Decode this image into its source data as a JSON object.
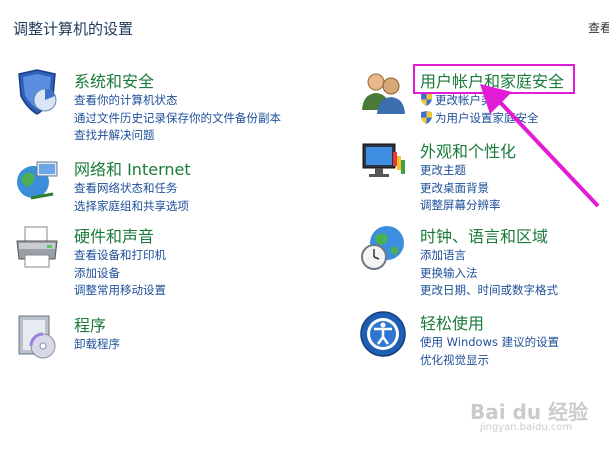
{
  "page": {
    "title": "调整计算机的设置",
    "view_by": "查看"
  },
  "categories": [
    {
      "id": "system-security",
      "icon": "shield-chart-icon",
      "title": "系统和安全",
      "links": [
        "查看你的计算机状态",
        "通过文件历史记录保存你的文件备份副本",
        "查找并解决问题"
      ]
    },
    {
      "id": "network-internet",
      "icon": "network-globe-icon",
      "title": "网络和 Internet",
      "links": [
        "查看网络状态和任务",
        "选择家庭组和共享选项"
      ]
    },
    {
      "id": "hardware-sound",
      "icon": "printer-icon",
      "title": "硬件和声音",
      "links": [
        "查看设备和打印机",
        "添加设备",
        "调整常用移动设置"
      ]
    },
    {
      "id": "programs",
      "icon": "programs-icon",
      "title": "程序",
      "links": [
        "卸载程序"
      ]
    },
    {
      "id": "user-accounts",
      "icon": "users-icon",
      "title": "用户帐户和家庭安全",
      "links": [
        "更改帐户类型",
        "为用户设置家庭安全"
      ]
    },
    {
      "id": "appearance",
      "icon": "monitor-paint-icon",
      "title": "外观和个性化",
      "links": [
        "更改主题",
        "更改桌面背景",
        "调整屏幕分辨率"
      ]
    },
    {
      "id": "clock-region",
      "icon": "clock-globe-icon",
      "title": "时钟、语言和区域",
      "links": [
        "添加语言",
        "更换输入法",
        "更改日期、时间或数字格式"
      ]
    },
    {
      "id": "ease-of-access",
      "icon": "ease-of-access-icon",
      "title": "轻松使用",
      "links": [
        "使用 Windows 建议的设置",
        "优化视觉显示"
      ]
    }
  ],
  "watermark": {
    "text": "Bai du 经验",
    "sub": "jingyan.baidu.com"
  },
  "colors": {
    "title_green": "#1a7a3a",
    "link_blue": "#1e4f98",
    "highlight": "#e21bd6"
  }
}
